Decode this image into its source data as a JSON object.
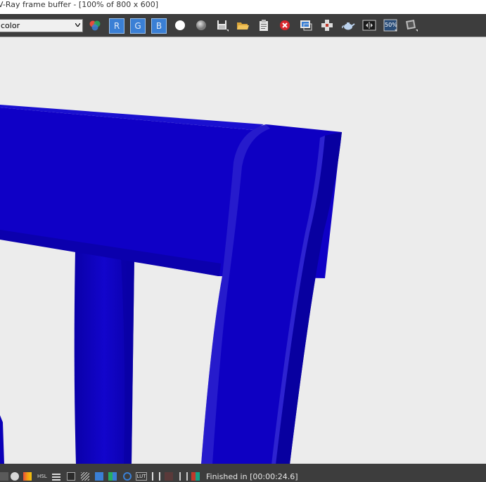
{
  "window": {
    "title": "V-Ray frame buffer - [100% of 800 x 600]"
  },
  "toolbar": {
    "channel_select_value": "color",
    "rgb_buttons": [
      {
        "label": "R"
      },
      {
        "label": "G"
      },
      {
        "label": "B"
      }
    ],
    "zoom_badge": "50%",
    "icons": [
      "rgb-channels-icon",
      "white-circle-icon",
      "gray-circle-icon",
      "save-icon",
      "open-folder-icon",
      "copy-clipboard-icon",
      "clear-icon",
      "track-mouse-icon",
      "region-render-icon",
      "teapot-render-icon",
      "compare-ab-icon",
      "zoom-50-icon",
      "render-settings-icon"
    ]
  },
  "status": {
    "text": "Finished in [00:00:24.6]",
    "icons": [
      "stop-icon",
      "info-icon",
      "color-gradient-icon",
      "hsl-icon",
      "levels-icon",
      "curves-icon",
      "histogram-icon",
      "exposure-icon",
      "whitebalance-icon",
      "lut-icon",
      "ocio-icon",
      "lens-icon",
      "lut-file-icon",
      "correction-h-icon",
      "stereo-icon",
      "pixel-aspect-icon"
    ],
    "hsl_label": "HSL",
    "lut_label": "LUT"
  },
  "colors": {
    "chair": "#0f00c6",
    "chair_dark": "#0900a2",
    "chair_highlight": "#3a32d6",
    "background": "#ececec",
    "toolbar": "#3d3d3d",
    "rgb_button": "#3a7fd5"
  }
}
